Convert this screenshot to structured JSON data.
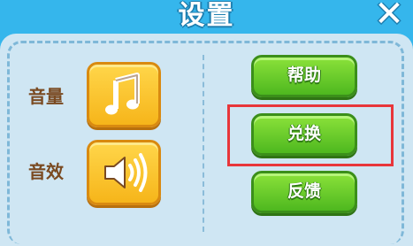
{
  "header": {
    "title": "设置"
  },
  "controls": {
    "volume_label": "音量",
    "sfx_label": "音效"
  },
  "buttons": {
    "help": "帮助",
    "redeem": "兑换",
    "feedback": "反馈"
  },
  "icons": {
    "close": "close-icon",
    "volume": "music-note-icon",
    "sfx": "speaker-icon"
  },
  "colors": {
    "background": "#35b6ec",
    "panel": "#cfe6f3",
    "yellow_button": "#f6b51a",
    "green_button": "#4eb81f",
    "highlight": "#e8363a",
    "label_text": "#7a4a21"
  }
}
